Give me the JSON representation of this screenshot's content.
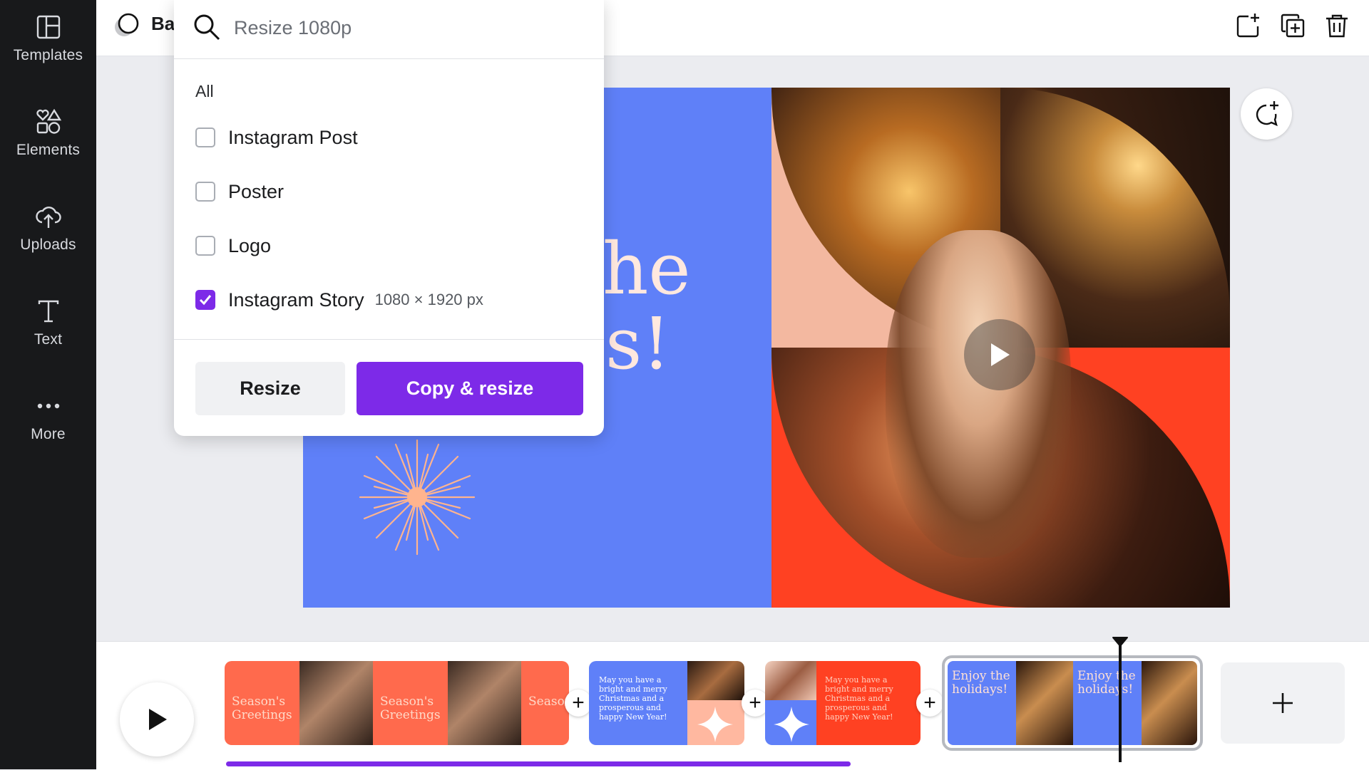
{
  "sidebar": {
    "items": [
      {
        "label": "Templates",
        "icon": "templates-icon"
      },
      {
        "label": "Elements",
        "icon": "elements-icon"
      },
      {
        "label": "Uploads",
        "icon": "uploads-icon"
      },
      {
        "label": "Text",
        "icon": "text-icon"
      },
      {
        "label": "More",
        "icon": "more-icon"
      }
    ]
  },
  "topbar": {
    "doc_name": "Ba",
    "icons": [
      "add-page-icon",
      "duplicate-icon",
      "trash-icon"
    ]
  },
  "resize_menu": {
    "search_placeholder": "Resize 1080p",
    "section_label": "All",
    "options": [
      {
        "name": "Instagram Post",
        "checked": false,
        "dimensions": ""
      },
      {
        "name": "Poster",
        "checked": false,
        "dimensions": ""
      },
      {
        "name": "Logo",
        "checked": false,
        "dimensions": ""
      },
      {
        "name": "Instagram Story",
        "checked": true,
        "dimensions": "1080 × 1920 px"
      }
    ],
    "resize_label": "Resize",
    "copy_resize_label": "Copy & resize"
  },
  "canvas": {
    "text_line1": "he",
    "text_line2": "s!"
  },
  "timeline": {
    "clips": [
      {
        "label": "Season's Greetings"
      },
      {
        "label": "May you have a bright and merry Christmas and a prosperous and happy New Year!"
      },
      {
        "label": "May you have a bright and merry Christmas and a prosperous and happy New Year!"
      },
      {
        "label": "Enjoy the holidays!"
      }
    ]
  },
  "colors": {
    "accent": "#7d2ae8",
    "canvas_blue": "#5f80f8",
    "coral": "#ff4b2b",
    "peach": "#ffb8a0",
    "sidebar_bg": "#18191b"
  }
}
